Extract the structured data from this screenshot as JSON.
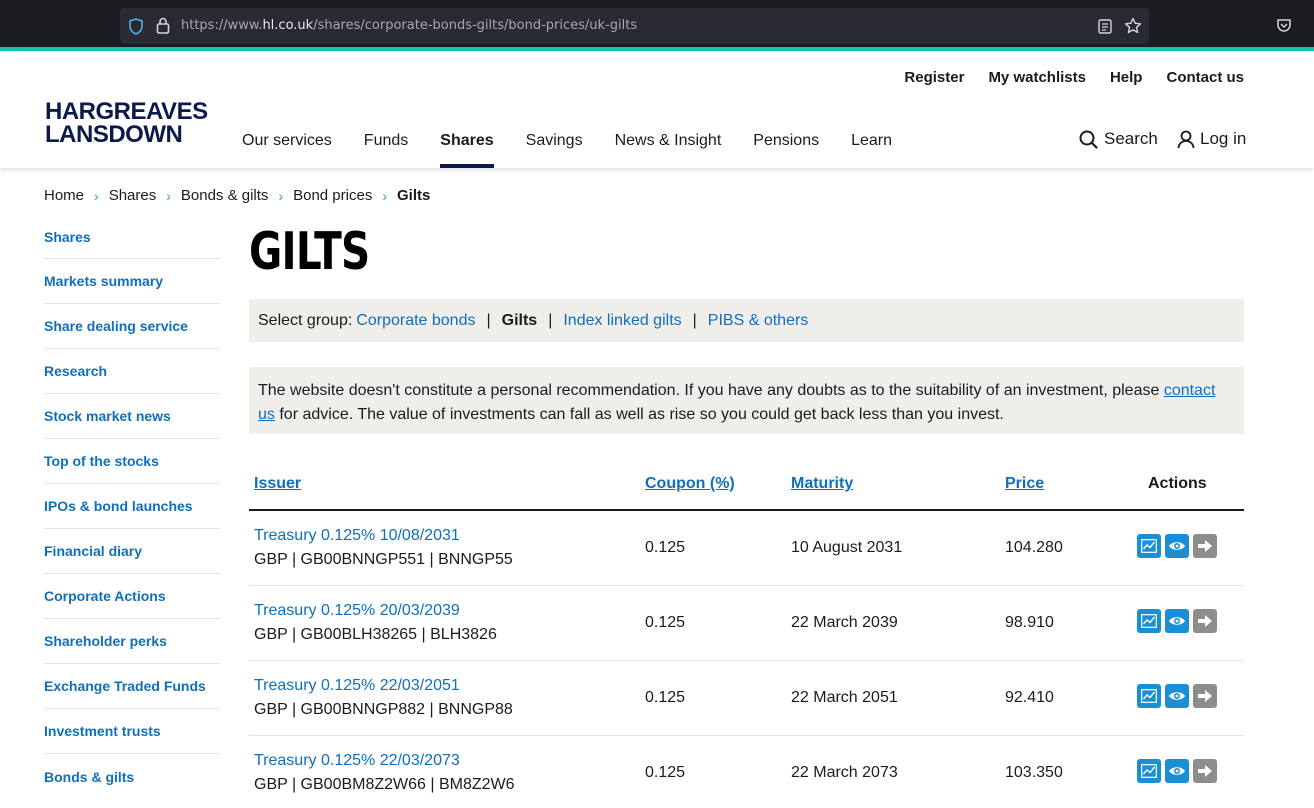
{
  "browser": {
    "url_prefix": "https://www.",
    "url_domain": "hl.co.uk",
    "url_path": "/shares/corporate-bonds-gilts/bond-prices/uk-gilts"
  },
  "header": {
    "logo_line1": "HARGREAVES",
    "logo_line2": "LANSDOWN",
    "utility": [
      "Register",
      "My watchlists",
      "Help",
      "Contact us"
    ],
    "nav": [
      "Our services",
      "Funds",
      "Shares",
      "Savings",
      "News & Insight",
      "Pensions",
      "Learn"
    ],
    "active_nav": "Shares",
    "search_label": "Search",
    "login_label": "Log in"
  },
  "breadcrumb": [
    "Home",
    "Shares",
    "Bonds & gilts",
    "Bond prices",
    "Gilts"
  ],
  "sidebar": [
    "Shares",
    "Markets summary",
    "Share dealing service",
    "Research",
    "Stock market news",
    "Top of the stocks",
    "IPOs & bond launches",
    "Financial diary",
    "Corporate Actions",
    "Shareholder perks",
    "Exchange Traded Funds",
    "Investment trusts",
    "Bonds & gilts"
  ],
  "page": {
    "title": "GILTS",
    "group_label": "Select group:",
    "groups": [
      "Corporate bonds",
      "Gilts",
      "Index linked gilts",
      "PIBS & others"
    ],
    "current_group": "Gilts",
    "disclaimer_before": "The website doesn't constitute a personal recommendation. If you have any doubts as to the suitability of an investment, please ",
    "disclaimer_link": "contact us",
    "disclaimer_after": " for advice. The value of investments can fall as well as rise so you could get back less than you invest."
  },
  "table": {
    "headers": {
      "issuer": "Issuer",
      "coupon": "Coupon (%)",
      "maturity": "Maturity",
      "price": "Price",
      "actions": "Actions"
    },
    "rows": [
      {
        "issuer": "Treasury 0.125% 10/08/2031",
        "codes": "GBP | GB00BNNGP551 | BNNGP55",
        "coupon": "0.125",
        "maturity": "10 August 2031",
        "price": "104.280"
      },
      {
        "issuer": "Treasury 0.125% 20/03/2039",
        "codes": "GBP | GB00BLH38265 | BLH3826",
        "coupon": "0.125",
        "maturity": "22 March 2039",
        "price": "98.910"
      },
      {
        "issuer": "Treasury 0.125% 22/03/2051",
        "codes": "GBP | GB00BNNGP882 | BNNGP88",
        "coupon": "0.125",
        "maturity": "22 March 2051",
        "price": "92.410"
      },
      {
        "issuer": "Treasury 0.125% 22/03/2073",
        "codes": "GBP | GB00BM8Z2W66 | BM8Z2W6",
        "coupon": "0.125",
        "maturity": "22 March 2073",
        "price": "103.350"
      }
    ]
  },
  "colors": {
    "link": "#0f6fbd",
    "accent": "#16c2ae",
    "brand": "#0c1a4b",
    "action_blue": "#1a8fd6",
    "action_grey": "#8d8d8d"
  }
}
